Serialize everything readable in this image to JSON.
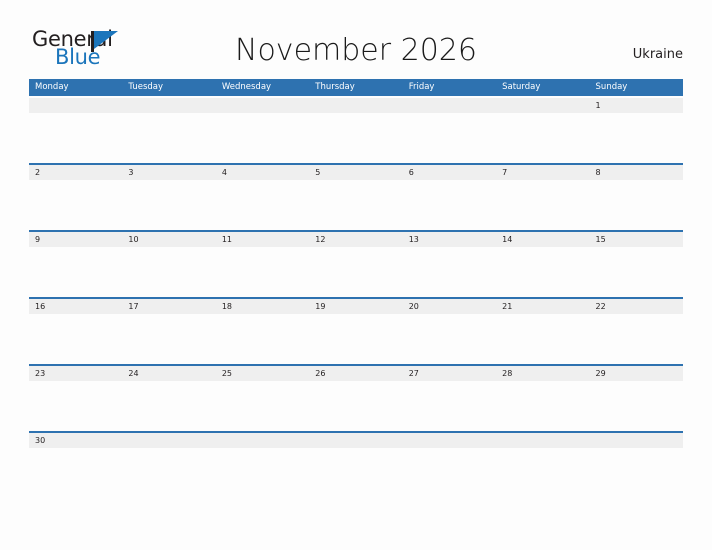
{
  "brand": {
    "name_part1": "General",
    "name_part2": "Blue",
    "flag_icon": "blue-triangle-flag"
  },
  "header": {
    "title": "November 2026",
    "region": "Ukraine"
  },
  "colors": {
    "header_blue": "#2e72b0",
    "rule_blue": "#2e72b0",
    "band_gray": "#efefef",
    "logo_blue": "#1b75bb",
    "page_bg": "#fdfdfd",
    "text_dark": "#231f20"
  },
  "calendar": {
    "month": "November",
    "year": "2026",
    "weekday_headers": [
      "Monday",
      "Tuesday",
      "Wednesday",
      "Thursday",
      "Friday",
      "Saturday",
      "Sunday"
    ],
    "weeks": [
      [
        "",
        "",
        "",
        "",
        "",
        "",
        "1"
      ],
      [
        "2",
        "3",
        "4",
        "5",
        "6",
        "7",
        "8"
      ],
      [
        "9",
        "10",
        "11",
        "12",
        "13",
        "14",
        "15"
      ],
      [
        "16",
        "17",
        "18",
        "19",
        "20",
        "21",
        "22"
      ],
      [
        "23",
        "24",
        "25",
        "26",
        "27",
        "28",
        "29"
      ],
      [
        "30",
        "",
        "",
        "",
        "",
        "",
        ""
      ]
    ]
  }
}
